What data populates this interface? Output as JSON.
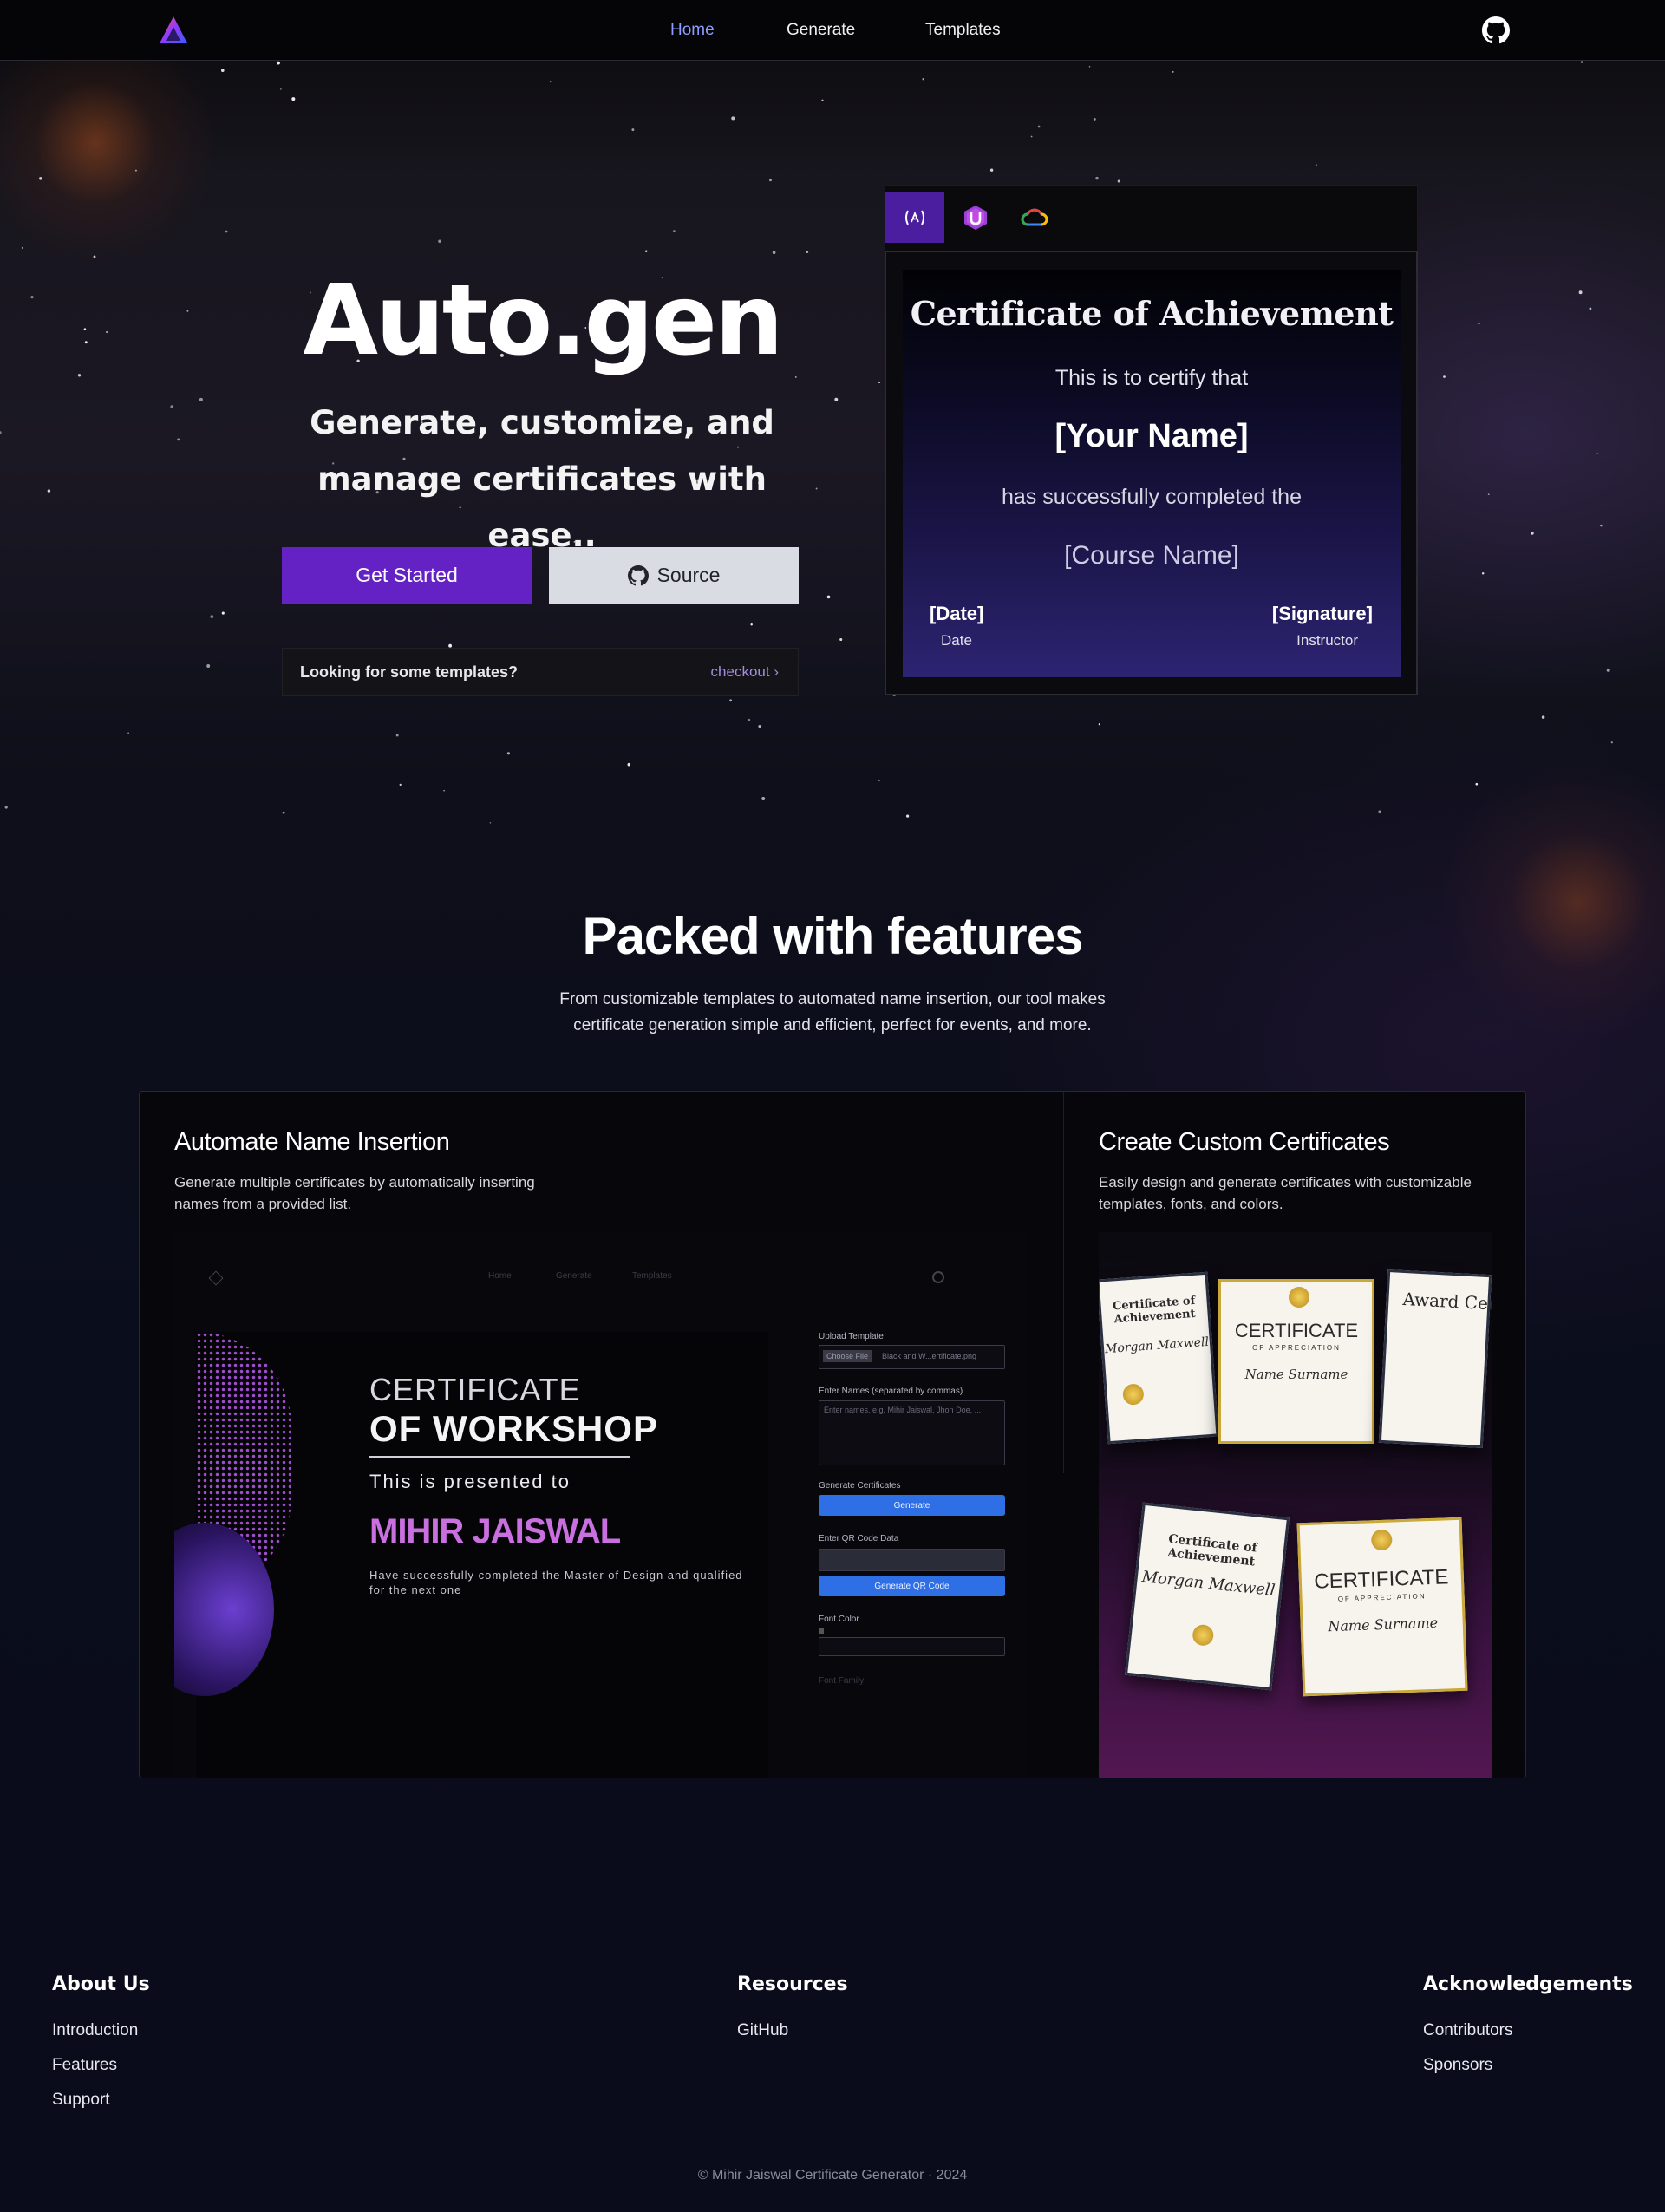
{
  "nav": {
    "links": [
      {
        "label": "Home",
        "active": true
      },
      {
        "label": "Generate",
        "active": false
      },
      {
        "label": "Templates",
        "active": false
      }
    ],
    "logo_icon": "autogen-logo-icon",
    "github_icon": "github-icon"
  },
  "hero": {
    "title": "Auto.gen",
    "subtitle": "Generate, customize, and manage certificates with ease..",
    "get_started": "Get Started",
    "source": "Source",
    "templates_prompt": "Looking for some templates?",
    "templates_link": "checkout"
  },
  "preview": {
    "tabs": [
      {
        "icon": "code-bracket-icon",
        "active": true
      },
      {
        "icon": "u-badge-icon",
        "active": false
      },
      {
        "icon": "cloud-icon",
        "active": false
      }
    ],
    "certificate": {
      "title": "Certificate of Achievement",
      "certify": "This is to certify that",
      "name": "[Your Name]",
      "completed": "has successfully completed the",
      "course": "[Course Name]",
      "date": "[Date]",
      "date_label": "Date",
      "signature": "[Signature]",
      "signature_label": "Instructor"
    }
  },
  "features": {
    "title": "Packed with features",
    "description": "From customizable templates to automated name insertion, our tool makes certificate generation simple and efficient, perfect for events, and more.",
    "cards": [
      {
        "title": "Automate Name Insertion",
        "text": "Generate multiple certificates by automatically inserting names from a provided list."
      },
      {
        "title": "Create Custom Certificates",
        "text": "Easily design and generate certificates with customizable templates, fonts, and colors."
      }
    ],
    "screenshot": {
      "nav": [
        "Home",
        "Generate",
        "Templates"
      ],
      "cert_line1": "CERTIFICATE",
      "cert_line2": "OF WORKSHOP",
      "presented": "This is presented to",
      "name": "MIHIR JAISWAL",
      "completed": "Have successfully completed the Master of Design and qualified for the next one",
      "upload_label": "Upload Template",
      "choose_file": "Choose File",
      "file_name": "Black and W...ertificate.png",
      "names_label": "Enter Names (separated by commas)",
      "names_placeholder": "Enter names, e.g. Mihir Jaiswal, Jhon Doe, ...",
      "generate_label": "Generate Certificates",
      "generate_btn": "Generate",
      "qr_label": "Enter QR Code Data",
      "qr_btn": "Generate QR Code",
      "font_color": "Font Color",
      "font_family": "Font Family"
    },
    "templates": {
      "achievement": "Certificate of Achievement",
      "appreciation": "CERTIFICATE",
      "appreciation_sub": "OF APPRECIATION",
      "name_a": "Morgan Maxwell",
      "name_b": "Name Surname",
      "award": "Award Certificate"
    }
  },
  "footer": {
    "columns": [
      {
        "title": "About Us",
        "links": [
          "Introduction",
          "Features",
          "Support"
        ]
      },
      {
        "title": "Resources",
        "links": [
          "GitHub"
        ]
      },
      {
        "title": "Acknowledgements",
        "links": [
          "Contributors",
          "Sponsors"
        ]
      }
    ],
    "copyright": "© Mihir Jaiswal Certificate Generator · 2024"
  },
  "colors": {
    "accent": "#6421c4",
    "nav_active": "#8e9cff",
    "link": "#a48de0",
    "blue_button": "#2f6fe6"
  }
}
